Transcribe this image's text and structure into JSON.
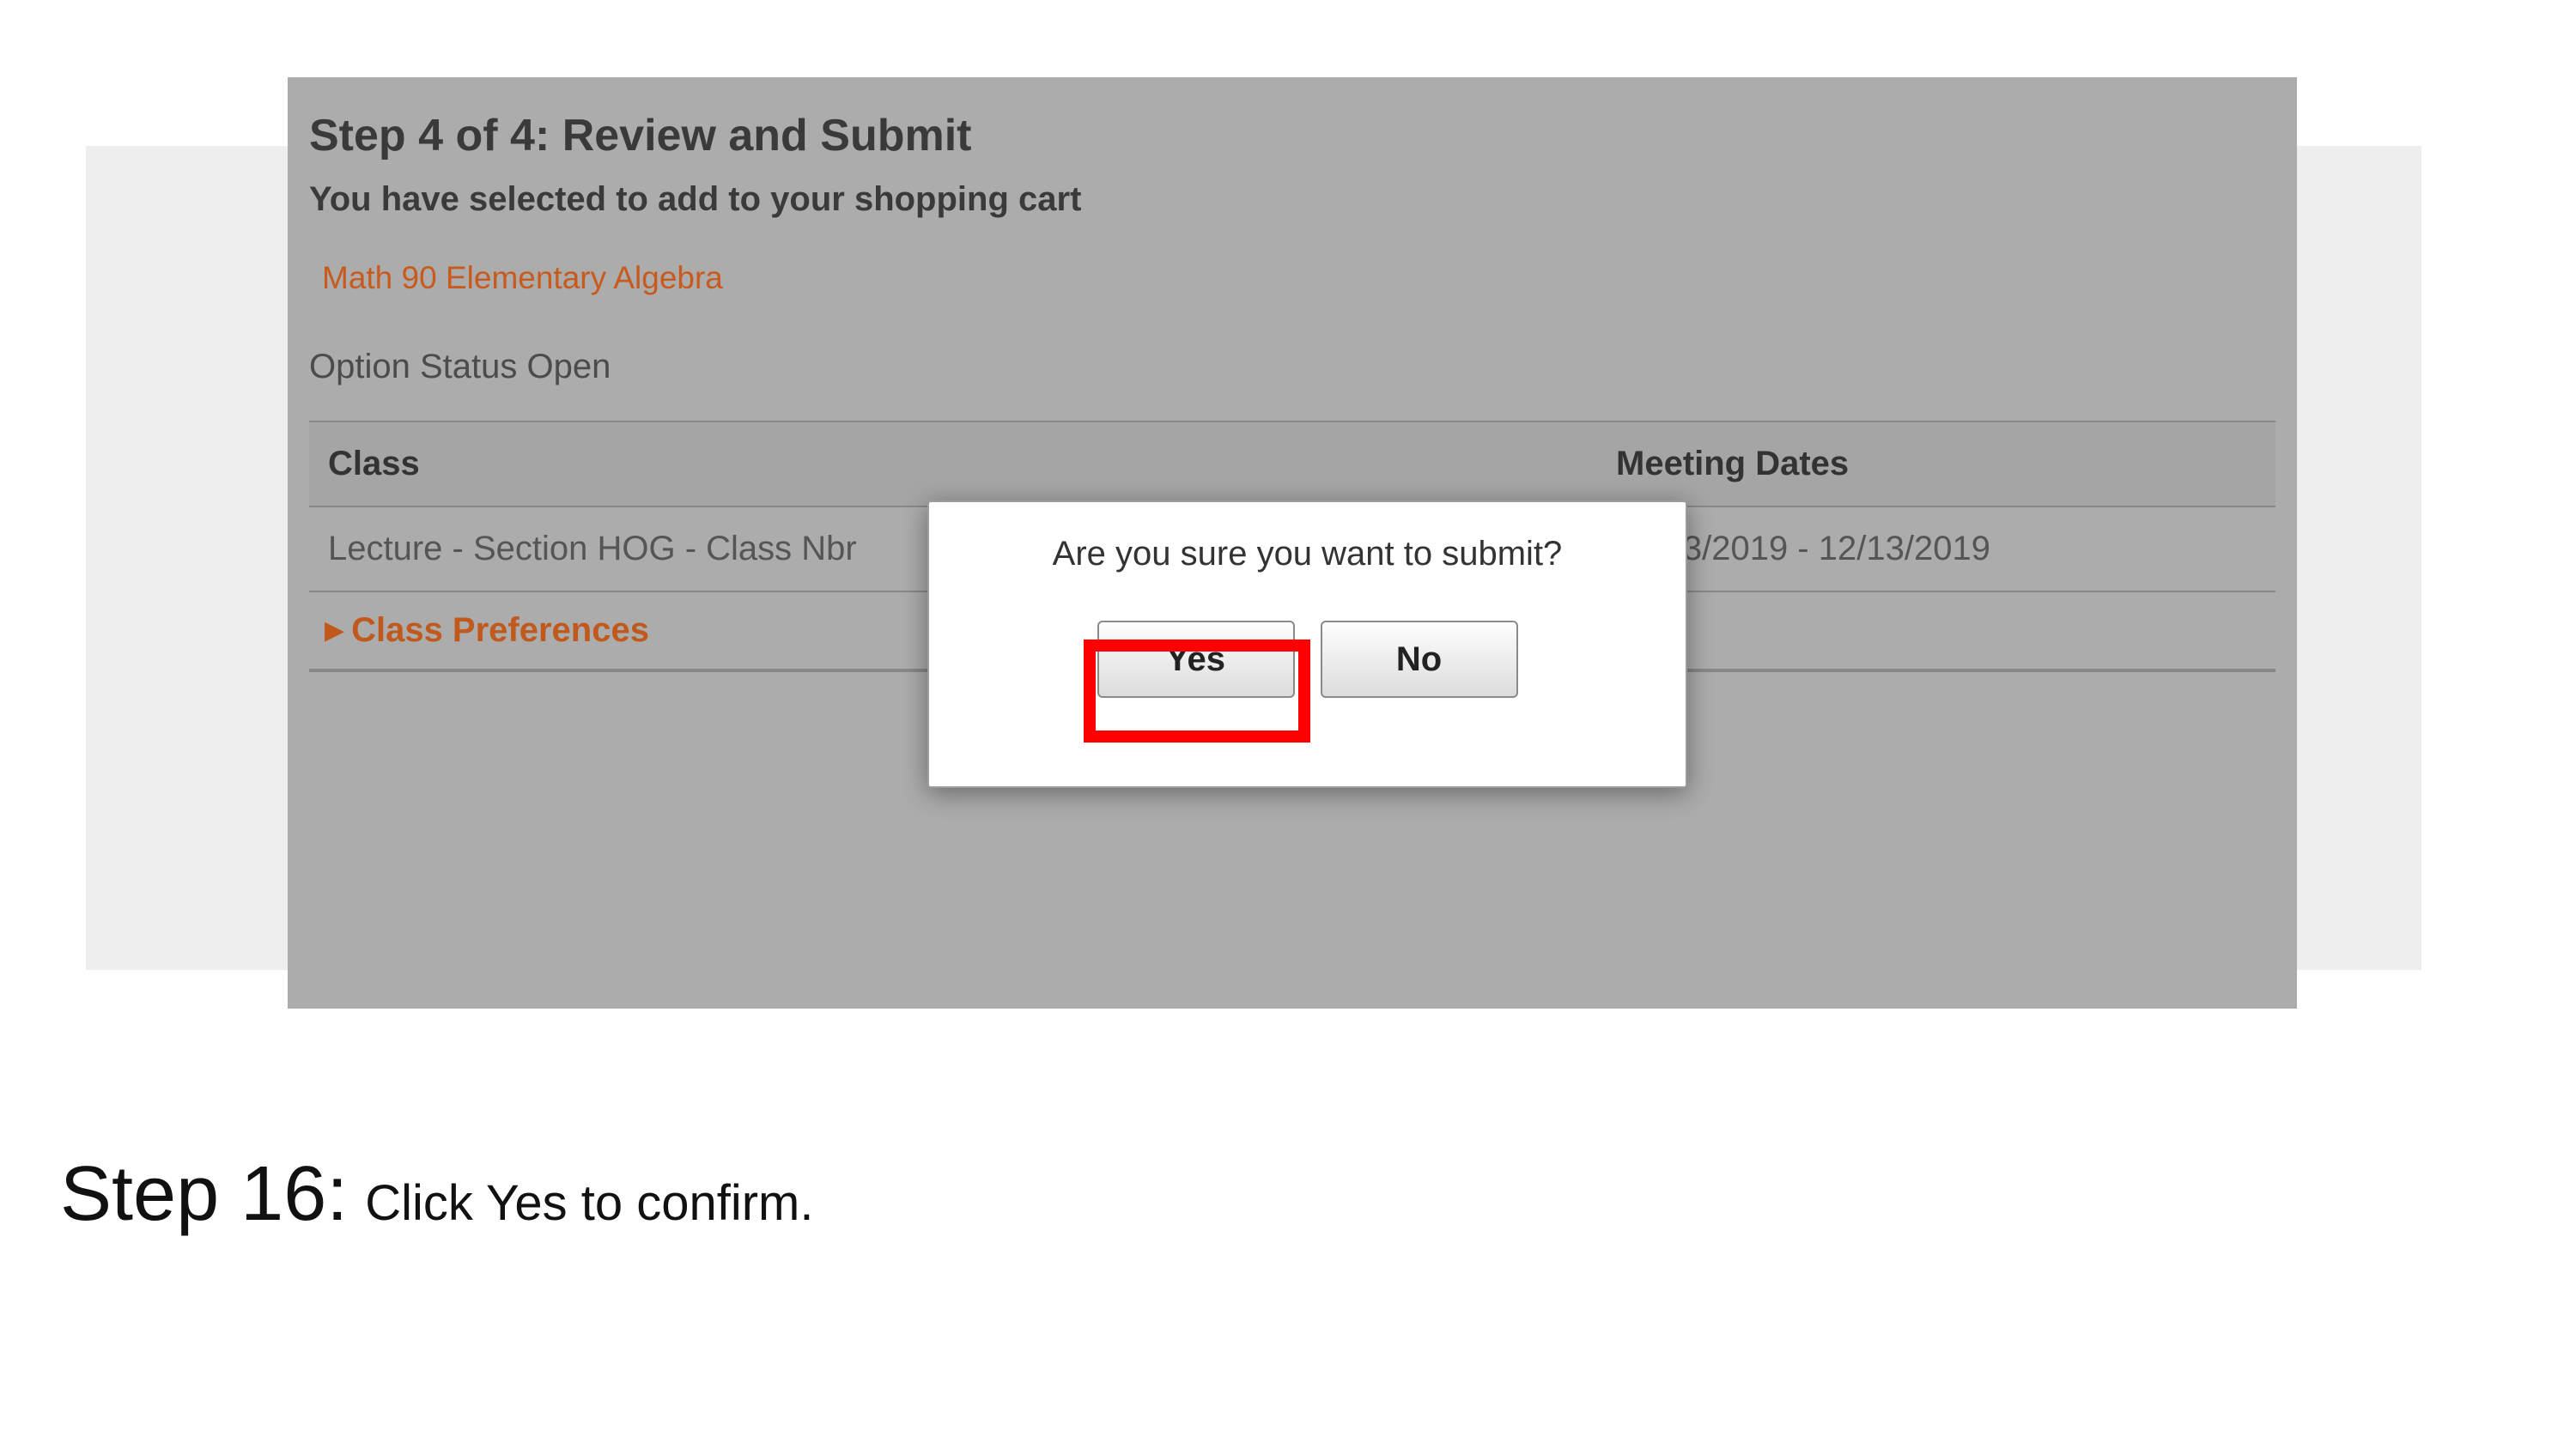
{
  "panel": {
    "heading": "Step 4 of 4: Review and Submit",
    "subheading": "You have selected to add to your shopping cart",
    "course": "Math 90  Elementary Algebra",
    "status": "Option Status  Open",
    "table": {
      "header_class": "Class",
      "header_dates": "Meeting Dates",
      "row_class": "Lecture - Section HOG - Class Nbr",
      "row_dates": "09/23/2019 - 12/13/2019"
    },
    "prefs_label": "Class Preferences"
  },
  "dialog": {
    "message": "Are you sure you want to submit?",
    "yes": "Yes",
    "no": "No"
  },
  "instruction": {
    "step": "Step 16:",
    "body_prefix": "Click ",
    "body_bold": "Yes",
    "body_suffix": " to confirm."
  }
}
